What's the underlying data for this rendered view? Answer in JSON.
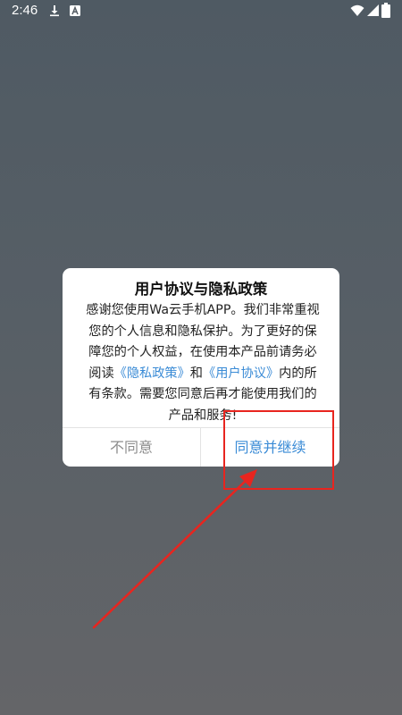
{
  "status_bar": {
    "time": "2:46",
    "icons": [
      "download-icon",
      "a-app-icon",
      "wifi-icon",
      "signal-icon",
      "battery-icon"
    ]
  },
  "dialog": {
    "title": "用户协议与隐私政策",
    "body_text_1": "感谢您使用Wa云手机APP。我们非常重视您的个人信息和隐私保护。为了更好的保障您的个人权益，在使用本产品前请务必阅读",
    "privacy_link": "《隐私政策》",
    "and_text": "和",
    "user_agreement_link": "《用户协议》",
    "body_text_2": "内的所有条款。需要您同意后再才能使用我们的产品和服务!",
    "disagree_button": "不同意",
    "agree_button": "同意并继续"
  },
  "colors": {
    "link": "#3a8bd6",
    "annotation": "#e8251f",
    "disagree": "#8c8c8c"
  }
}
